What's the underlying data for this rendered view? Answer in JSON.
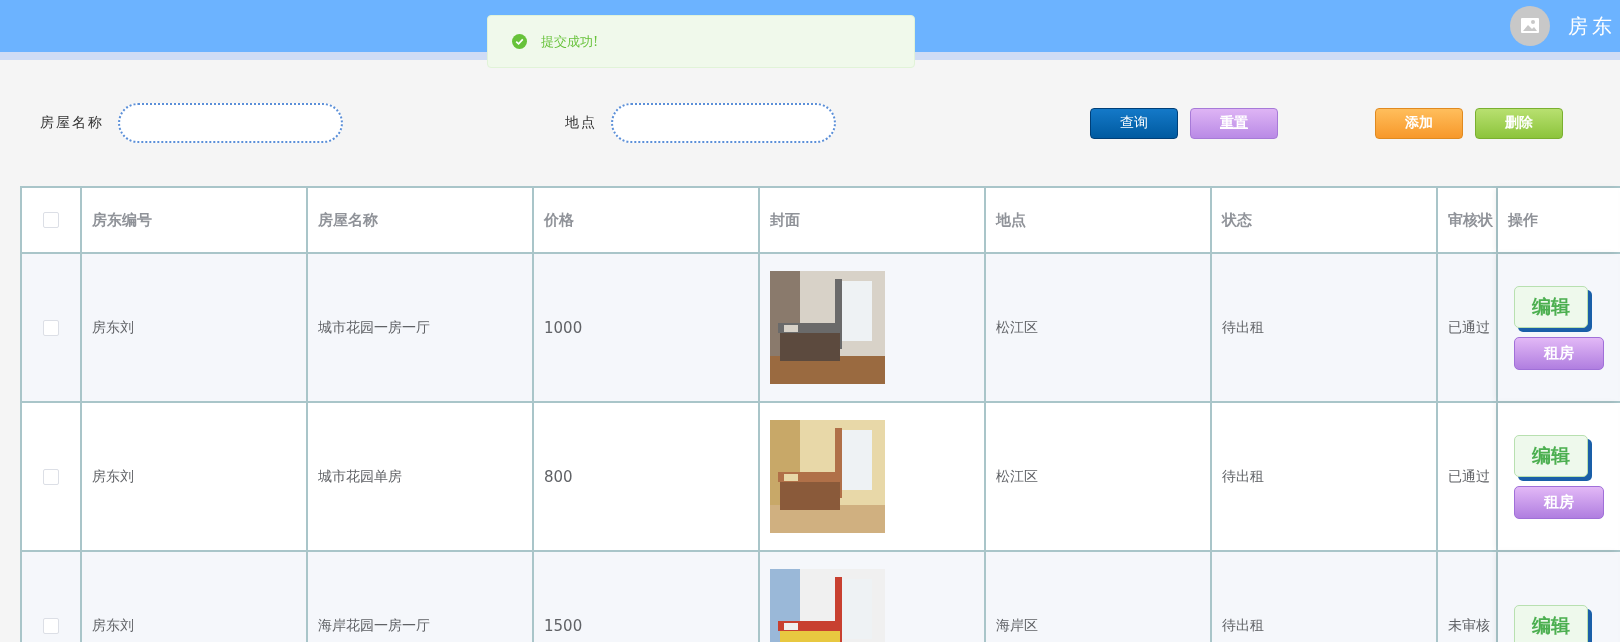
{
  "header": {
    "user_name": "房东"
  },
  "toast": {
    "message": "提交成功!"
  },
  "search": {
    "fields": [
      {
        "label": "房屋名称"
      },
      {
        "label": "地点"
      }
    ],
    "buttons": [
      {
        "label": "查询",
        "kind": "query"
      },
      {
        "label": "重置",
        "kind": "reset"
      },
      {
        "label": "添加",
        "kind": "add"
      },
      {
        "label": "删除",
        "kind": "delete"
      }
    ]
  },
  "table": {
    "header_checked": false,
    "columns": [
      "房东编号",
      "房屋名称",
      "价格",
      "封面",
      "地点",
      "状态",
      "审核状",
      "操作"
    ],
    "rows": [
      {
        "checked": false,
        "landlord": "房东刘",
        "name": "城市花园一房一厅",
        "price": "1000",
        "cover": {
          "kind": "picture"
        },
        "location": "松江区",
        "status": "待出租",
        "review": "已通过",
        "actions": [
          "编辑",
          "租房"
        ]
      },
      {
        "checked": false,
        "landlord": "房东刘",
        "name": "城市花园单房",
        "price": "800",
        "cover": {
          "kind": "picture"
        },
        "location": "松江区",
        "status": "待出租",
        "review": "已通过",
        "actions": [
          "编辑",
          "租房"
        ]
      },
      {
        "checked": false,
        "landlord": "房东刘",
        "name": "海岸花园一房一厅",
        "price": "1500",
        "cover": {
          "kind": "picture"
        },
        "location": "海岸区",
        "status": "待出租",
        "review": "未审核",
        "actions": [
          "编辑"
        ]
      }
    ]
  }
}
